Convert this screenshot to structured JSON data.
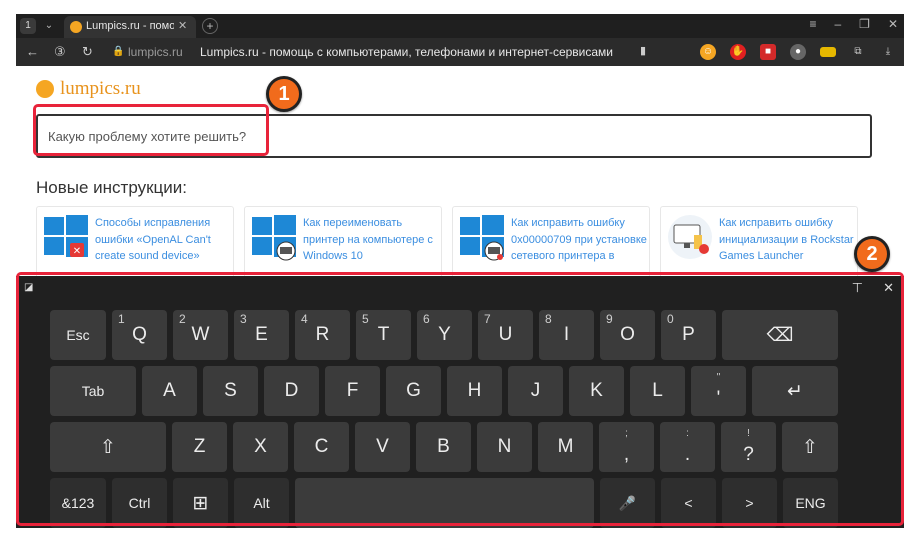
{
  "browser": {
    "tab_count": "1",
    "tab_title": "Lumpics.ru - помощь с",
    "url_domain": "lumpics.ru",
    "url_title": "Lumpics.ru - помощь с компьютерами, телефонами и интернет-сервисами"
  },
  "site": {
    "logo": "lumpics.ru",
    "search_placeholder": "Какую проблему хотите решить?",
    "section_title": "Новые инструкции:",
    "cards": [
      {
        "title": "Способы исправления ошибки «OpenAL Can't create sound device»"
      },
      {
        "title": "Как переименовать принтер на компьютере с Windows 10"
      },
      {
        "title": "Как исправить ошибку 0x00000709 при установке сетевого принтера в"
      },
      {
        "title": "Как исправить ошибку инициализации в Rockstar Games Launcher"
      }
    ]
  },
  "annotations": {
    "badge1": "1",
    "badge2": "2"
  },
  "keyboard": {
    "row1": [
      {
        "label": "Esc"
      },
      {
        "label": "Q",
        "num": "1"
      },
      {
        "label": "W",
        "num": "2"
      },
      {
        "label": "E",
        "num": "3"
      },
      {
        "label": "R",
        "num": "4"
      },
      {
        "label": "T",
        "num": "5"
      },
      {
        "label": "Y",
        "num": "6"
      },
      {
        "label": "U",
        "num": "7"
      },
      {
        "label": "I",
        "num": "8"
      },
      {
        "label": "O",
        "num": "9"
      },
      {
        "label": "P",
        "num": "0"
      },
      {
        "label": "⌫"
      }
    ],
    "row2": [
      {
        "label": "Tab"
      },
      {
        "label": "A"
      },
      {
        "label": "S"
      },
      {
        "label": "D"
      },
      {
        "label": "F"
      },
      {
        "label": "G"
      },
      {
        "label": "H"
      },
      {
        "label": "J"
      },
      {
        "label": "K"
      },
      {
        "label": "L"
      },
      {
        "label": "'",
        "top": "\""
      },
      {
        "label": "↵"
      }
    ],
    "row3": [
      {
        "label": "⇧"
      },
      {
        "label": "Z"
      },
      {
        "label": "X"
      },
      {
        "label": "C"
      },
      {
        "label": "V"
      },
      {
        "label": "B"
      },
      {
        "label": "N"
      },
      {
        "label": "M"
      },
      {
        "label": ",",
        "top": ";"
      },
      {
        "label": ".",
        "top": ":"
      },
      {
        "label": "?",
        "top": "!"
      },
      {
        "label": "⇧"
      }
    ],
    "row4": [
      {
        "label": "&123"
      },
      {
        "label": "Ctrl"
      },
      {
        "label": "⊞"
      },
      {
        "label": "Alt"
      },
      {
        "label": ""
      },
      {
        "label": "🎤"
      },
      {
        "label": "<"
      },
      {
        "label": ">"
      },
      {
        "label": "ENG"
      }
    ]
  },
  "colors": {
    "accent_red": "#e8233a",
    "badge_orange": "#f16b1c",
    "link_blue": "#3b8ee0",
    "logo_orange": "#e8931d"
  }
}
